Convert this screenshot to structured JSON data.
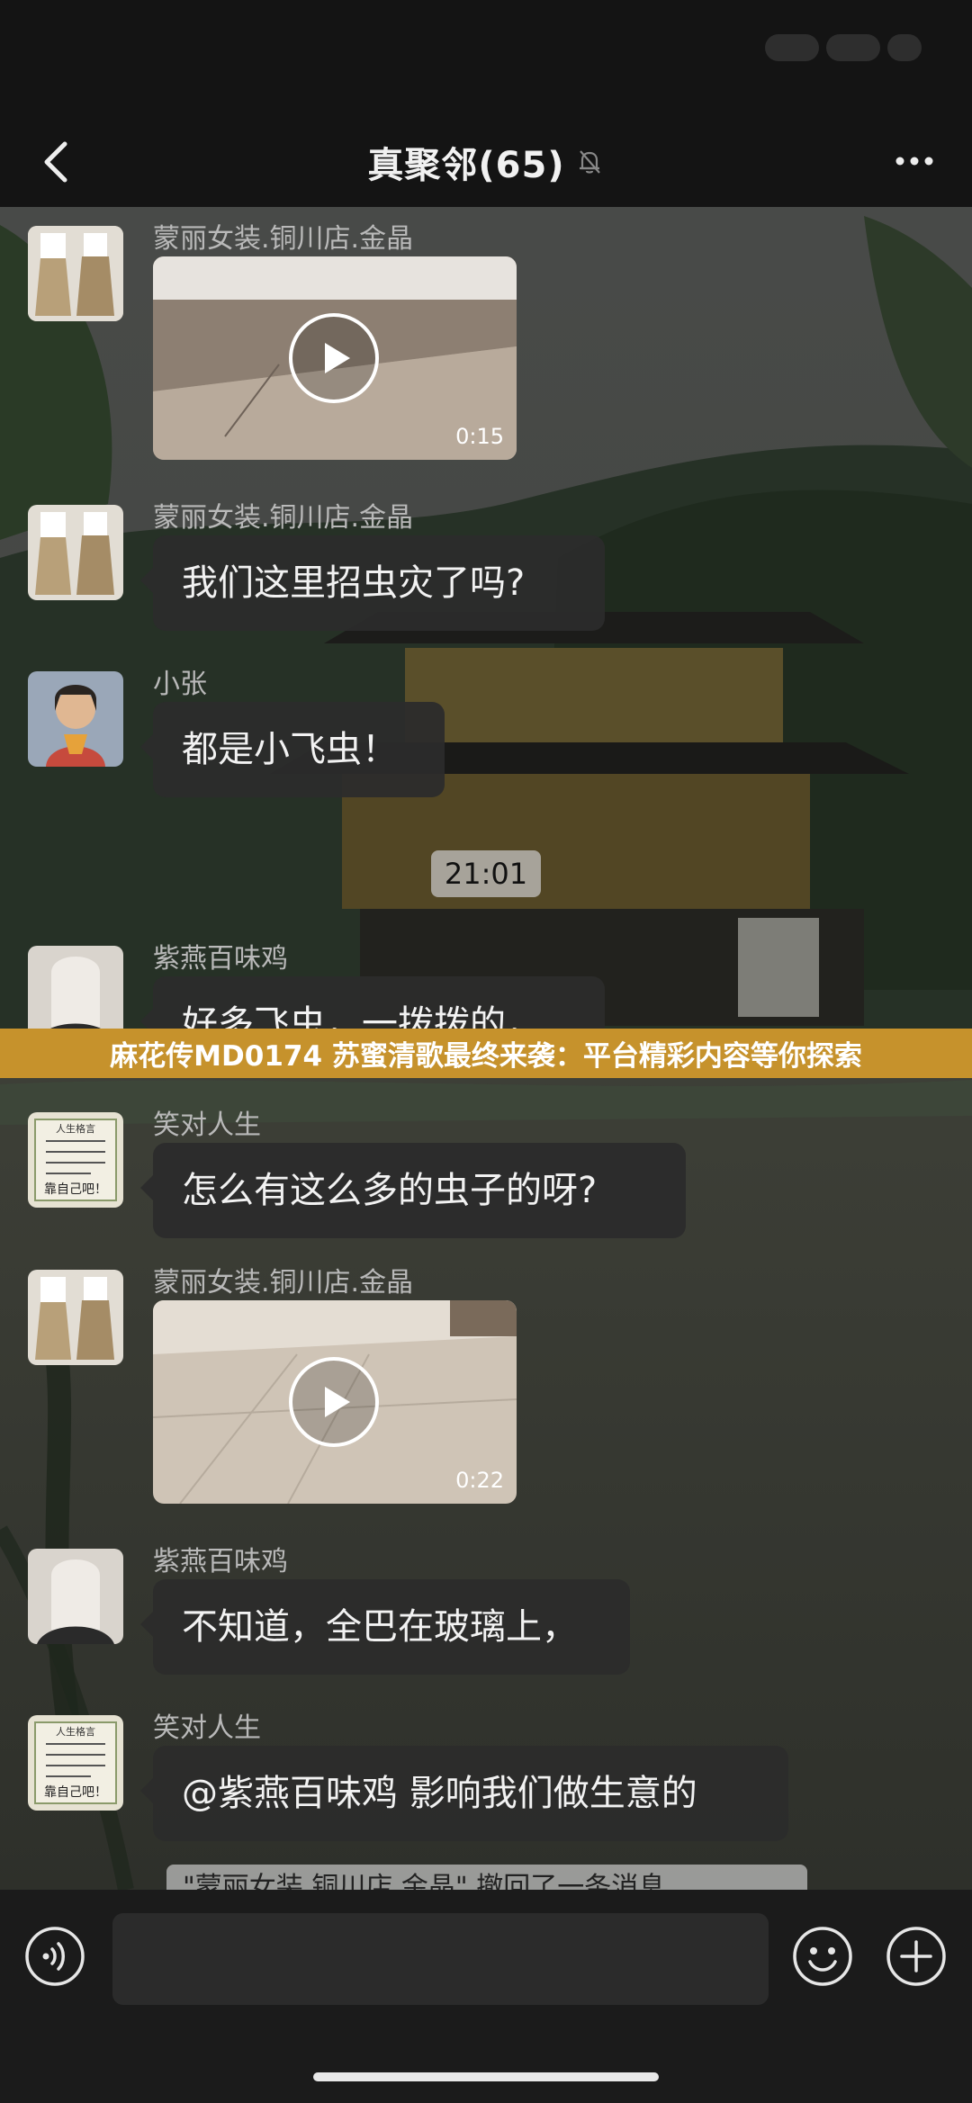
{
  "header": {
    "title": "真聚邻(65)",
    "back_icon": "chevron-left-icon",
    "mute_icon": "bell-off-icon",
    "more_icon": "more-dots-icon"
  },
  "messages": [
    {
      "sender": "蒙丽女装.铜川店.金晶",
      "type": "video",
      "duration": "0:15"
    },
    {
      "sender": "蒙丽女装.铜川店.金晶",
      "type": "text",
      "text": "我们这里招虫灾了吗?"
    },
    {
      "sender": "小张",
      "type": "text",
      "text": "都是小飞虫！"
    },
    {
      "sender": "紫燕百味鸡",
      "type": "text",
      "text": "好多飞虫，一拨拨的，"
    },
    {
      "sender": "笑对人生",
      "type": "text",
      "text": "怎么有这么多的虫子的呀?"
    },
    {
      "sender": "蒙丽女装.铜川店.金晶",
      "type": "video",
      "duration": "0:22"
    },
    {
      "sender": "紫燕百味鸡",
      "type": "text",
      "text": "不知道，全巴在玻璃上，"
    },
    {
      "sender": "笑对人生",
      "type": "text",
      "text": "@紫燕百味鸡 影响我们做生意的"
    }
  ],
  "time_divider": "21:01",
  "recall_notice": "\"蒙丽女装.铜川店.金晶\" 撤回了一条消息",
  "banner": "麻花传MD0174 苏蜜清歌最终来袭：平台精彩内容等你探索",
  "avatar_text": {
    "poster_title": "人生格言",
    "poster_sign": "靠自己吧！"
  },
  "input_bar": {
    "voice_icon": "voice-icon",
    "emoji_icon": "emoji-icon",
    "plus_icon": "plus-icon",
    "input_value": ""
  },
  "colors": {
    "banner": "#c6922c",
    "bubble": "#2c2c2c",
    "bar": "#141414"
  }
}
